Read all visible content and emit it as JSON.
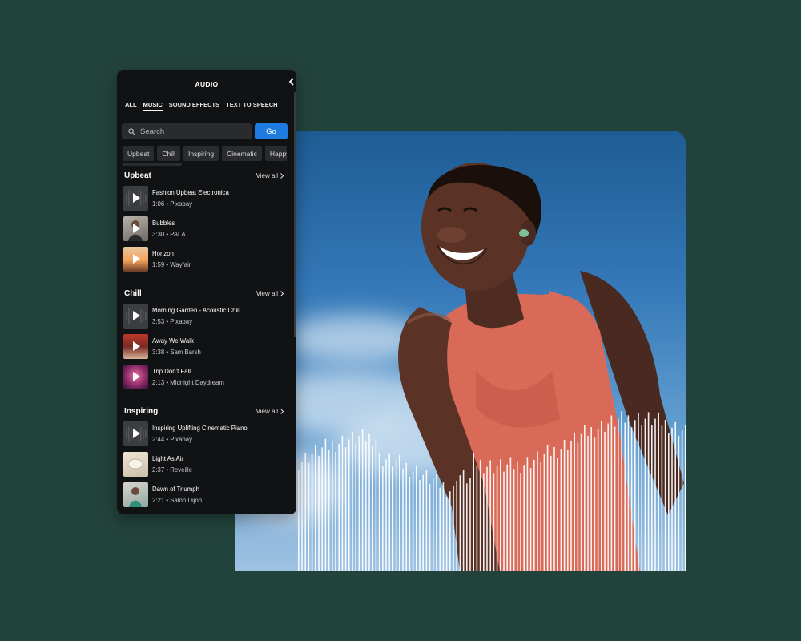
{
  "panel": {
    "title": "AUDIO",
    "tabs": [
      {
        "label": "ALL",
        "active": false
      },
      {
        "label": "MUSIC",
        "active": true
      },
      {
        "label": "SOUND EFFECTS",
        "active": false
      },
      {
        "label": "TEXT TO SPEECH",
        "active": false
      }
    ],
    "search": {
      "placeholder": "Search",
      "go_label": "Go"
    },
    "chips": [
      "Upbeat",
      "Chill",
      "Inspiring",
      "Cinematic",
      "Happy"
    ],
    "view_all_label": "View all",
    "sections": [
      {
        "title": "Upbeat",
        "tracks": [
          {
            "name": "Fashion Upbeat Electronica",
            "meta": "1:06 • Pixabay",
            "thumb": "waveform-placeholder"
          },
          {
            "name": "Bubbles",
            "meta": "3:30 • PALA",
            "thumb": "portrait-photo"
          },
          {
            "name": "Horizon",
            "meta": "1:59 • Wayfair",
            "thumb": "sunset-photo"
          }
        ]
      },
      {
        "title": "Chill",
        "tracks": [
          {
            "name": "Morning Garden - Acoustic Chill",
            "meta": "3:53 • Pixabay",
            "thumb": "waveform-placeholder"
          },
          {
            "name": "Away We Walk",
            "meta": "3:38 • Sam Barsh",
            "thumb": "album-art-red"
          },
          {
            "name": "Trip Don't Fall",
            "meta": "2:13 • Midnight Daydream",
            "thumb": "album-art-pink"
          }
        ]
      },
      {
        "title": "Inspiring",
        "tracks": [
          {
            "name": "Inspiring Uplifting Cinematic Piano",
            "meta": "2:44 • Pixabay",
            "thumb": "waveform-placeholder"
          },
          {
            "name": "Light As Air",
            "meta": "2:37 • Reveille",
            "thumb": "album-art-cream"
          },
          {
            "name": "Dawn of Triumph",
            "meta": "2:21 • Salon Dijon",
            "thumb": "album-art-teal"
          }
        ]
      }
    ]
  },
  "colors": {
    "background": "#22433b",
    "panel": "#111214",
    "accent": "#1e7be0",
    "sky": "#3478b8",
    "tank_top": "#d96a57"
  }
}
